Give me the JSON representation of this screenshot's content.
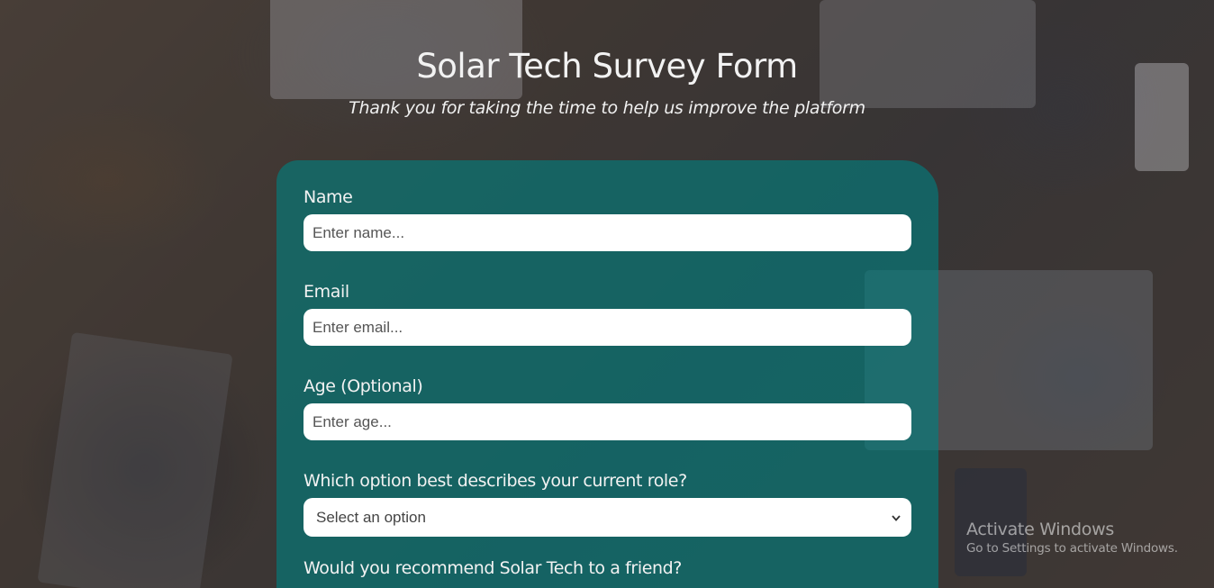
{
  "header": {
    "title": "Solar Tech Survey Form",
    "subtitle": "Thank you for taking the time to help us improve the platform"
  },
  "form": {
    "name": {
      "label": "Name",
      "placeholder": "Enter name...",
      "value": ""
    },
    "email": {
      "label": "Email",
      "placeholder": "Enter email...",
      "value": ""
    },
    "age": {
      "label": "Age (Optional)",
      "placeholder": "Enter age...",
      "value": ""
    },
    "role": {
      "label": "Which option best describes your current role?",
      "selected": "Select an option",
      "icon": "chevron-down-icon"
    },
    "recommend": {
      "label": "Would you recommend Solar Tech to a friend?"
    }
  },
  "watermark": {
    "title": "Activate Windows",
    "subtitle": "Go to Settings to activate Windows."
  },
  "colors": {
    "card": "#008080",
    "input_bg": "#ffffff",
    "text": "#f2f2f2"
  }
}
